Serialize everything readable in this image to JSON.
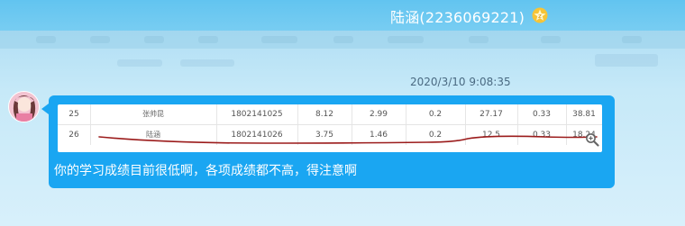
{
  "window": {
    "title": "陆涵(2236069221)",
    "badge_icon": "vip-star-icon"
  },
  "message": {
    "timestamp": "2020/3/10 9:08:35",
    "text": "你的学习成绩目前很低啊，各项成绩都不高，得注意啊"
  },
  "table_image": {
    "rows": [
      {
        "cells": [
          "25",
          "张帅昆",
          "1802141025",
          "8.12",
          "2.99",
          "0.2",
          "27.17",
          "0.33",
          "38.81"
        ]
      },
      {
        "cells": [
          "26",
          "陆涵",
          "1802141026",
          "3.75",
          "1.46",
          "0.2",
          "12.5",
          "0.33",
          "18.24"
        ]
      }
    ],
    "annotation": "red-underline",
    "annotation_color": "#9b1b1b",
    "zoom_icon": "zoom-in-icon"
  },
  "colors": {
    "title_bar": "#6bc8f1",
    "bubble": "#1aa6f2",
    "text_light": "#ffffff"
  }
}
